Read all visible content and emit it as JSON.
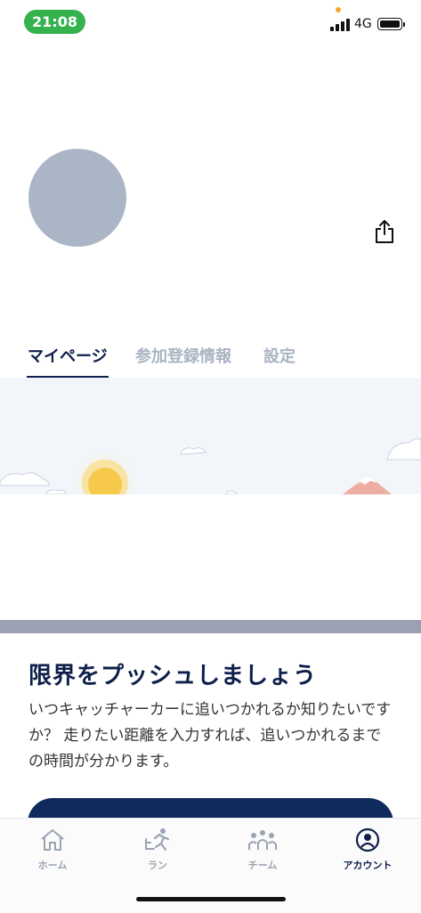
{
  "status_bar": {
    "time": "21:08",
    "network": "4G"
  },
  "tabs": [
    {
      "label": "マイページ",
      "active": true
    },
    {
      "label": "参加登録情報",
      "active": false
    },
    {
      "label": "設定",
      "active": false
    }
  ],
  "feature": {
    "title": "限界をプッシュしましょう",
    "description": "いつキャッチャーカーに追いつかれるか知りたいですか？ 走りたい距離を入力すれば、追いつかれるまでの時間が分かります。"
  },
  "bottom_nav": [
    {
      "label": "ホーム",
      "icon": "home-icon"
    },
    {
      "label": "ラン",
      "icon": "run-icon"
    },
    {
      "label": "チーム",
      "icon": "team-icon"
    },
    {
      "label": "アカウント",
      "icon": "account-icon",
      "active": true
    }
  ],
  "colors": {
    "accent": "#0f1f4b",
    "inactive": "#a9b4c4",
    "status_pill": "#33b24d",
    "avatar": "#aab6c6"
  }
}
